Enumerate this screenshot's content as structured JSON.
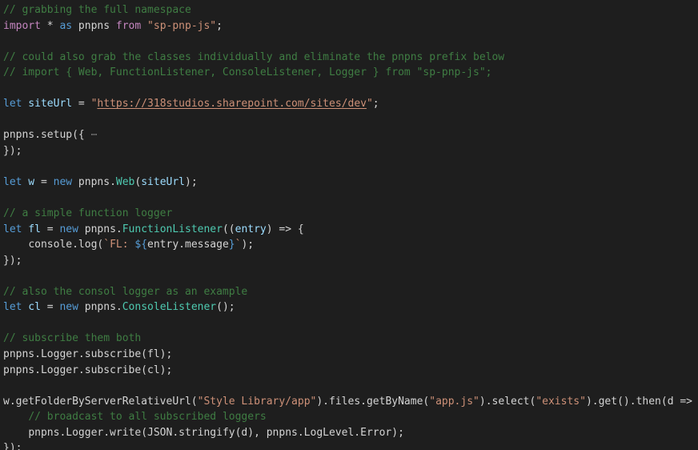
{
  "editor": {
    "language": "typescript",
    "theme": "dark",
    "background_color": "#1e1e1e",
    "colors": {
      "comment": "#3f7d43",
      "keyword": "#569cd6",
      "control_keyword": "#c586c0",
      "string": "#ce9178",
      "plain_text": "#d4d4d4",
      "variable": "#9cdcfe",
      "type": "#4ec9b0",
      "fold_placeholder": "#7a7a7a"
    },
    "lines": [
      {
        "n": 1,
        "text": "// grabbing the full namespace"
      },
      {
        "n": 2,
        "text": "import * as pnpns from \"sp-pnp-js\";"
      },
      {
        "n": 3,
        "text": ""
      },
      {
        "n": 4,
        "text": "// could also grab the classes individually and eliminate the pnpns prefix below"
      },
      {
        "n": 5,
        "text": "// import { Web, FunctionListener, ConsoleListener, Logger } from \"sp-pnp-js\";"
      },
      {
        "n": 6,
        "text": ""
      },
      {
        "n": 7,
        "text": "let siteUrl = \"https://318studios.sharepoint.com/sites/dev\";"
      },
      {
        "n": 8,
        "text": ""
      },
      {
        "n": 9,
        "text": "pnpns.setup({ ⋯"
      },
      {
        "n": 10,
        "text": "});"
      },
      {
        "n": 11,
        "text": ""
      },
      {
        "n": 12,
        "text": "let w = new pnpns.Web(siteUrl);"
      },
      {
        "n": 13,
        "text": ""
      },
      {
        "n": 14,
        "text": "// a simple function logger"
      },
      {
        "n": 15,
        "text": "let fl = new pnpns.FunctionListener((entry) => {"
      },
      {
        "n": 16,
        "text": "    console.log(`FL: ${entry.message}`);"
      },
      {
        "n": 17,
        "text": "});"
      },
      {
        "n": 18,
        "text": ""
      },
      {
        "n": 19,
        "text": "// also the consol logger as an example"
      },
      {
        "n": 20,
        "text": "let cl = new pnpns.ConsoleListener();"
      },
      {
        "n": 21,
        "text": ""
      },
      {
        "n": 22,
        "text": "// subscribe them both"
      },
      {
        "n": 23,
        "text": "pnpns.Logger.subscribe(fl);"
      },
      {
        "n": 24,
        "text": "pnpns.Logger.subscribe(cl);"
      },
      {
        "n": 25,
        "text": ""
      },
      {
        "n": 26,
        "text": "w.getFolderByServerRelativeUrl(\"Style Library/app\").files.getByName(\"app.js\").select(\"exists\").get().then(d => {"
      },
      {
        "n": 27,
        "text": "    // broadcast to all subscribed loggers"
      },
      {
        "n": 28,
        "text": "    pnpns.Logger.write(JSON.stringify(d), pnpns.LogLevel.Error);"
      },
      {
        "n": 29,
        "text": "});"
      }
    ],
    "tokens": {
      "l1": {
        "comment": "// grabbing the full namespace"
      },
      "l2": {
        "import": "import",
        "star": " * ",
        "as": "as",
        "namespace": " pnpns ",
        "from": "from",
        "module": " \"sp-pnp-js\"",
        "semi": ";"
      },
      "l4": {
        "comment": "// could also grab the classes individually and eliminate the pnpns prefix below"
      },
      "l5": {
        "comment": "// import { Web, FunctionListener, ConsoleListener, Logger } from \"sp-pnp-js\";"
      },
      "l7": {
        "let": "let",
        "name": " siteUrl",
        "equals": " = ",
        "quote_open": "\"",
        "url": "https://318studios.sharepoint.com/sites/dev",
        "quote_close": "\"",
        "semi": ";"
      },
      "l9": {
        "call": "pnpns.setup({ ",
        "fold": "⋯"
      },
      "l10": {
        "close": "});"
      },
      "l12": {
        "let": "let",
        "name": " w",
        "equals": " = ",
        "new": "new",
        "ns": " pnpns.",
        "type": "Web",
        "open": "(",
        "arg": "siteUrl",
        "close": ");"
      },
      "l14": {
        "comment": "// a simple function logger"
      },
      "l15": {
        "let": "let",
        "name": " fl",
        "equals": " = ",
        "new": "new",
        "ns": " pnpns.",
        "type": "FunctionListener",
        "open": "((",
        "param": "entry",
        "arrow": ") => {"
      },
      "l16": {
        "indent": "    ",
        "call": "console.log(",
        "tick_open": "`",
        "str": "FL: ",
        "expr_open": "${",
        "expr": "entry.message",
        "expr_close": "}",
        "tick_close": "`",
        "end": ");"
      },
      "l17": {
        "close": "});"
      },
      "l19": {
        "comment": "// also the consol logger as an example"
      },
      "l20": {
        "let": "let",
        "name": " cl",
        "equals": " = ",
        "new": "new",
        "ns": " pnpns.",
        "type": "ConsoleListener",
        "close": "();"
      },
      "l22": {
        "comment": "// subscribe them both"
      },
      "l23": {
        "text": "pnpns.Logger.subscribe(fl);"
      },
      "l24": {
        "text": "pnpns.Logger.subscribe(cl);"
      },
      "l26": {
        "a": "w.getFolderByServerRelativeUrl(",
        "s1": "\"Style Library/app\"",
        "b": ").files.getByName(",
        "s2": "\"app.js\"",
        "c": ").select(",
        "s3": "\"exists\"",
        "d": ").get().then(d => {"
      },
      "l27": {
        "indent": "    ",
        "comment": "// broadcast to all subscribed loggers"
      },
      "l28": {
        "indent": "    ",
        "text": "pnpns.Logger.write(JSON.stringify(d), pnpns.LogLevel.Error);"
      },
      "l29": {
        "close": "});"
      }
    }
  }
}
